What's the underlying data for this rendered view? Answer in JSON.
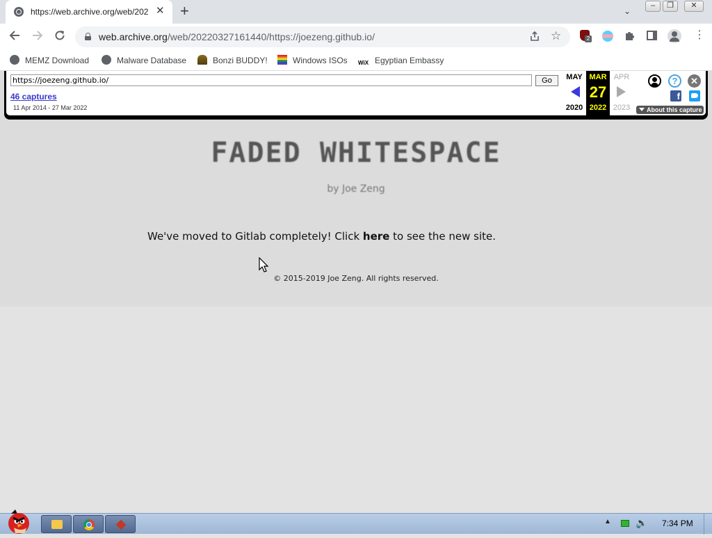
{
  "browser": {
    "tab": {
      "title": "https://web.archive.org/web/202"
    },
    "omnibox": {
      "url_host": "web.archive.org",
      "url_path": "/web/20220327161440/https://joezeng.github.io/"
    },
    "extensions": {
      "badge": "2"
    },
    "bookmarks": [
      {
        "label": "MEMZ Download",
        "icon": "globe-icon"
      },
      {
        "label": "Malware Database",
        "icon": "globe-icon"
      },
      {
        "label": "Bonzi BUDDY!",
        "icon": "bonzi-icon"
      },
      {
        "label": "Windows ISOs",
        "icon": "windows-flag-icon"
      },
      {
        "label": "Egyptian Embassy",
        "icon": "wix-icon",
        "icon_text": "WiX"
      }
    ]
  },
  "wayback": {
    "url_value": "https://joezeng.github.io/",
    "go_label": "Go",
    "captures": "46 captures",
    "range": "11 Apr 2014 - 27 Mar 2022",
    "prev": {
      "month": "MAY",
      "year": "2020"
    },
    "current": {
      "month": "MAR",
      "day": "27",
      "year": "2022"
    },
    "next": {
      "month": "APR",
      "year": "2023"
    },
    "about": "About this capture",
    "help_glyph": "?",
    "close_glyph": "✕",
    "fb_glyph": "f"
  },
  "site": {
    "title": "FADED WHITESPACE",
    "byline": "by Joe Zeng",
    "moved_before": "We've moved to Gitlab completely! Click ",
    "moved_link": "here",
    "moved_after": " to see the new site.",
    "copyright": "© 2015-2019 Joe Zeng. All rights reserved."
  },
  "taskbar": {
    "clock": "7:34 PM"
  },
  "colors": {
    "wayback_current": "#ffff00",
    "wayback_link": "#3939ce",
    "page_bg": "#dcdcdc"
  }
}
